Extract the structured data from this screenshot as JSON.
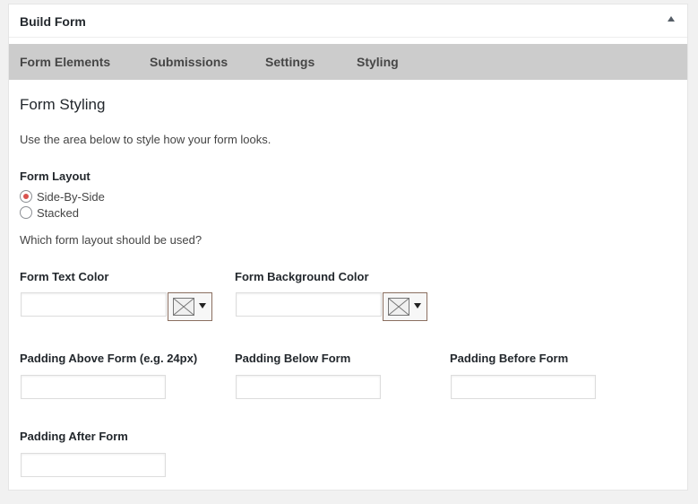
{
  "panel": {
    "title": "Build Form",
    "toggle_icon": "caret-up-icon"
  },
  "tabs": [
    {
      "label": "Form Elements"
    },
    {
      "label": "Submissions"
    },
    {
      "label": "Settings"
    },
    {
      "label": "Styling"
    }
  ],
  "styling": {
    "heading": "Form Styling",
    "description": "Use the area below to style how your form looks.",
    "layout": {
      "label": "Form Layout",
      "options": [
        {
          "label": "Side-By-Side",
          "checked": true
        },
        {
          "label": "Stacked",
          "checked": false
        }
      ],
      "help": "Which form layout should be used?"
    },
    "text_color": {
      "label": "Form Text Color",
      "value": "",
      "swatch_icon": "no-color-icon",
      "dropdown_icon": "caret-down-icon"
    },
    "background_color": {
      "label": "Form Background Color",
      "value": "",
      "swatch_icon": "no-color-icon",
      "dropdown_icon": "caret-down-icon"
    },
    "padding_above": {
      "label": "Padding Above Form (e.g. 24px)",
      "value": ""
    },
    "padding_below": {
      "label": "Padding Below Form",
      "value": ""
    },
    "padding_before": {
      "label": "Padding Before Form",
      "value": ""
    },
    "padding_after": {
      "label": "Padding After Form",
      "value": ""
    }
  },
  "colors": {
    "tab_bar": "#cccccc",
    "radio_checked": "#d9534f"
  }
}
